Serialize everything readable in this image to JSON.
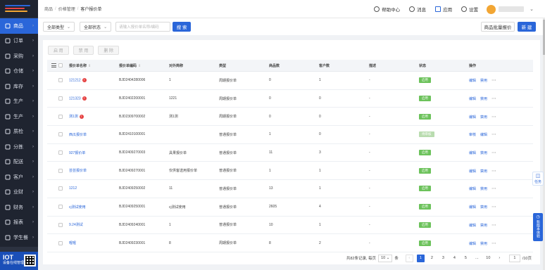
{
  "sidebar": {
    "items": [
      {
        "label": "商品",
        "icon": "shop-icon",
        "active": true
      },
      {
        "label": "订单",
        "icon": "order-icon"
      },
      {
        "label": "采购",
        "icon": "purchase-icon"
      },
      {
        "label": "仓储",
        "icon": "warehouse-icon"
      },
      {
        "label": "库存",
        "icon": "inventory-icon"
      },
      {
        "label": "生产",
        "icon": "production-icon"
      },
      {
        "label": "生产",
        "icon": "production-icon"
      },
      {
        "label": "质检",
        "icon": "inspect-icon"
      },
      {
        "label": "分拣",
        "icon": "sort-icon"
      },
      {
        "label": "配送",
        "icon": "delivery-icon"
      },
      {
        "label": "客户",
        "icon": "customer-icon"
      },
      {
        "label": "业财",
        "icon": "finance-icon"
      },
      {
        "label": "财务",
        "icon": "finance-icon"
      },
      {
        "label": "报表",
        "icon": "report-icon"
      },
      {
        "label": "学生餐",
        "icon": "meal-icon"
      }
    ],
    "footer": {
      "title": "IOT",
      "subtitle": "设备在线管理"
    }
  },
  "header": {
    "breadcrumb": [
      "商品",
      "价格管理",
      "客户报价单"
    ],
    "help": "帮助中心",
    "messages": "消息",
    "apps": "应用",
    "settings": "设置"
  },
  "filter": {
    "type_select": "全部类型",
    "status_select": "全部状态",
    "search_placeholder": "请输入报价单名称/编码",
    "search_button": "搜 索",
    "batch_button": "商品批量报价",
    "new_button": "新 建"
  },
  "actions": {
    "enable": "启 用",
    "disable": "禁 用",
    "delete": "删 除"
  },
  "table": {
    "columns": [
      "报价单名称",
      "报价单编码",
      "对外简称",
      "类型",
      "商品数",
      "客户数",
      "描述",
      "状态",
      "操作"
    ],
    "rows": [
      {
        "name": "121212",
        "flag": "!",
        "code": "BJD2404280006",
        "alias": "1",
        "type": "周期报价单",
        "goods": "0",
        "customers": "1",
        "desc": "-",
        "status": "启用",
        "status_on": true,
        "ops": [
          "编辑",
          "禁用"
        ]
      },
      {
        "name": "121323",
        "flag": "!",
        "code": "BJD2402200001",
        "alias": "1221",
        "type": "周期报价单",
        "goods": "0",
        "customers": "0",
        "desc": "-",
        "status": "启用",
        "status_on": true,
        "ops": [
          "编辑",
          "禁用"
        ]
      },
      {
        "name": "测1测",
        "flag": "!",
        "code": "BJD2309700002",
        "alias": "测1测",
        "type": "周期报价单",
        "goods": "0",
        "customers": "0",
        "desc": "-",
        "status": "启用",
        "status_on": true,
        "ops": [
          "编辑",
          "禁用"
        ]
      },
      {
        "name": "西瓜报价单",
        "flag": "",
        "code": "BJD2410100001",
        "alias": "",
        "type": "普通报价单",
        "goods": "1",
        "customers": "0",
        "desc": "-",
        "status": "待审核",
        "status_on": false,
        "ops": [
          "审核",
          "编辑"
        ]
      },
      {
        "name": "927报价单",
        "flag": "",
        "code": "BJD2409270003",
        "alias": "具果报价单",
        "type": "普通报价单",
        "goods": "11",
        "customers": "3",
        "desc": "-",
        "status": "启用",
        "status_on": true,
        "ops": [
          "编辑",
          "禁用"
        ]
      },
      {
        "name": "芸芸报价单",
        "flag": "",
        "code": "BJD2409270001",
        "alias": "仅供客送用报价单",
        "type": "普通报价单",
        "goods": "1",
        "customers": "1",
        "desc": "-",
        "status": "启用",
        "status_on": true,
        "ops": [
          "编辑",
          "禁用"
        ]
      },
      {
        "name": "1212",
        "flag": "",
        "code": "BJD2409250002",
        "alias": "11",
        "type": "普通报价单",
        "goods": "13",
        "customers": "1",
        "desc": "-",
        "status": "启用",
        "status_on": true,
        "ops": [
          "编辑",
          "禁用"
        ]
      },
      {
        "name": "cj测试使用",
        "flag": "",
        "code": "BJD2409250001",
        "alias": "cj测试使用",
        "type": "普通报价单",
        "goods": "2605",
        "customers": "4",
        "desc": "-",
        "status": "启用",
        "status_on": true,
        "ops": [
          "编辑",
          "禁用"
        ]
      },
      {
        "name": "9.24测试",
        "flag": "",
        "code": "BJD2409240001",
        "alias": "1",
        "type": "普通报价单",
        "goods": "10",
        "customers": "1",
        "desc": "-",
        "status": "启用",
        "status_on": true,
        "ops": [
          "编辑",
          "禁用"
        ]
      },
      {
        "name": "喔喔",
        "flag": "",
        "code": "BJD2409230001",
        "alias": "8",
        "type": "周期报价单",
        "goods": "8",
        "customers": "2",
        "desc": "-",
        "status": "启用",
        "status_on": true,
        "ops": [
          "编辑",
          "禁用"
        ]
      }
    ]
  },
  "pager": {
    "total_text": "共82条记录, 每页",
    "page_size": "10",
    "unit": "条",
    "pages": [
      "1",
      "2",
      "3",
      "4",
      "5",
      "...",
      "10"
    ],
    "jump_value": "1",
    "page_total": "/10页"
  },
  "floating": {
    "task": "任务",
    "new_feature": "新版本体验"
  },
  "colors": {
    "primary": "#2a66d9",
    "sidebar": "#1f2430",
    "status_on": "#6cc25b"
  }
}
